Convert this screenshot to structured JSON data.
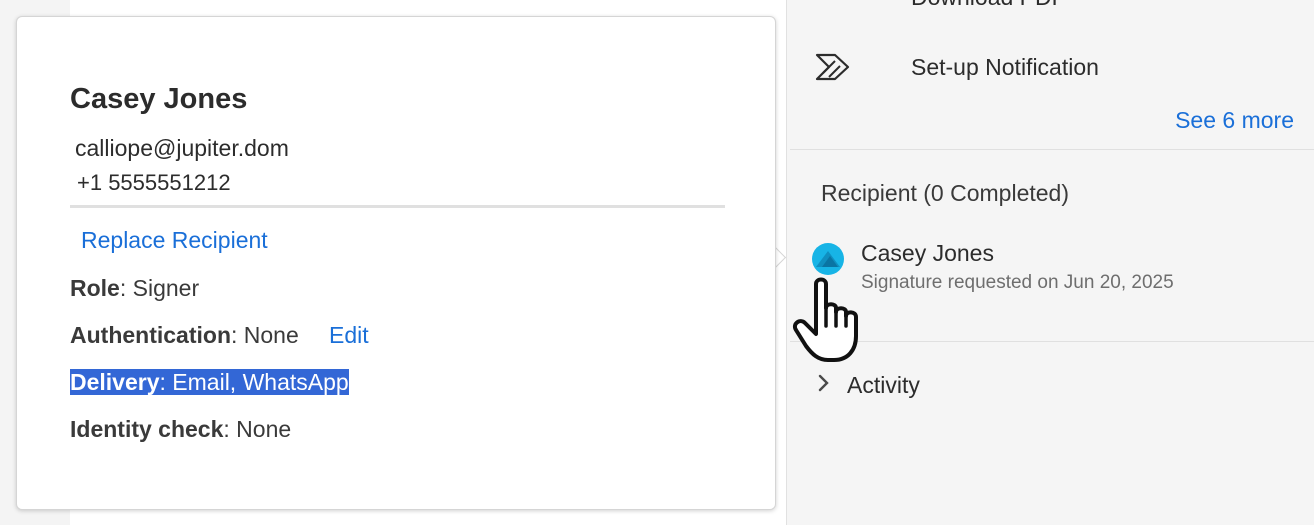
{
  "card": {
    "name": "Casey Jones",
    "email": "calliope@jupiter.dom",
    "phone": "+1 5555551212",
    "replace_link": "Replace Recipient",
    "role_label": "Role",
    "role_value": ": Signer",
    "auth_label": "Authentication",
    "auth_value": ": None",
    "edit_link": "Edit",
    "delivery_label": "Delivery",
    "delivery_value": ": Email, WhatsApp",
    "identity_label": "Identity check",
    "identity_value": ": None"
  },
  "sidebar": {
    "download_label": "Download PDF",
    "notification_label": "Set-up Notification",
    "see_more": "See 6 more",
    "recipient_section_title": "Recipient (0 Completed)",
    "recipient_name": "Casey Jones",
    "recipient_status": "Signature requested on Jun 20, 2025",
    "activity_label": "Activity"
  },
  "colors": {
    "link": "#1a6fd8",
    "selection": "#3367d6",
    "avatar": "#17b4e6"
  },
  "icons": [
    "download-icon",
    "notification-icon",
    "avatar-icon",
    "chevron-right-icon",
    "hand-pointer-cursor-icon"
  ]
}
